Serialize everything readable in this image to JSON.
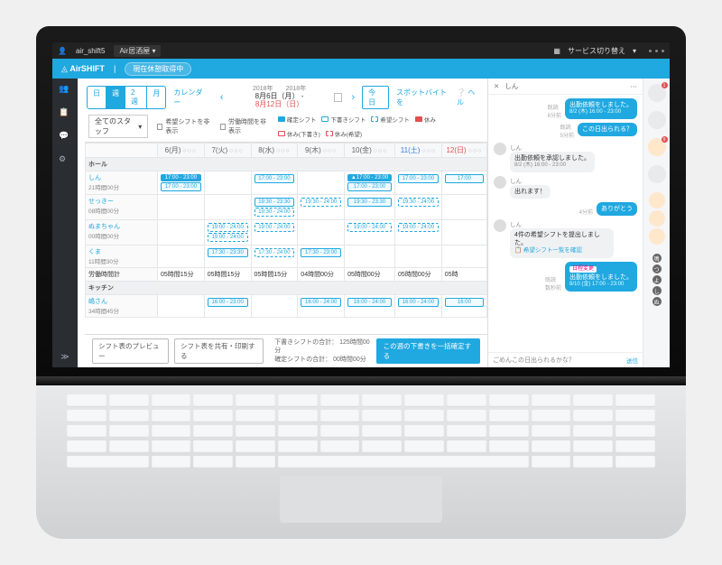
{
  "sysbar": {
    "user": "air_shift5",
    "store": "Air居酒屋",
    "svc": "サービス切り替え"
  },
  "app": {
    "brand": "AirSHIFT",
    "status": "現在休憩取得中"
  },
  "toolbar": {
    "views": [
      "日",
      "週",
      "2週",
      "月"
    ],
    "active": 1,
    "calendar": "カレンダー",
    "year": "2018年",
    "from": "8月6日（月）",
    "to": "8月12日（日）",
    "today": "今日",
    "help": "ヘル",
    "spot": "スポットバイトを"
  },
  "filters": {
    "staff": "全てのスタッフ",
    "cb1": "希望シフトを非表示",
    "cb2": "労働時間を非表示",
    "lg": [
      "確定シフト",
      "下書きシフト",
      "希望シフト",
      "休み",
      "休み(下書き)",
      "休み(希望)"
    ]
  },
  "days": [
    {
      "n": "6",
      "w": "(月)",
      "cls": ""
    },
    {
      "n": "7",
      "w": "(火)",
      "cls": ""
    },
    {
      "n": "8",
      "w": "(水)",
      "cls": ""
    },
    {
      "n": "9",
      "w": "(木)",
      "cls": ""
    },
    {
      "n": "10",
      "w": "(金)",
      "cls": ""
    },
    {
      "n": "11",
      "w": "(土)",
      "cls": "sat"
    },
    {
      "n": "12",
      "w": "(日)",
      "cls": "sun"
    }
  ],
  "sections": {
    "hall": "ホール",
    "sum": "労働時間計",
    "kitchen": "キッチン"
  },
  "staff": [
    {
      "nm": "しん",
      "hrs": "21時間00分",
      "cells": [
        [
          {
            "t": "17:00 - 23:00",
            "s": "c-solid"
          },
          {
            "t": "17:00 - 23:00",
            "s": "c-outline"
          }
        ],
        [],
        [
          {
            "t": "17:00 - 23:00",
            "s": "c-outline"
          }
        ],
        [],
        [
          {
            "t": "▲17:00 - 23:00",
            "s": "c-solid"
          },
          {
            "t": "17:00 - 23:00",
            "s": "c-outline"
          }
        ],
        [
          {
            "t": "17:00 - 23:00",
            "s": "c-outline"
          }
        ],
        [
          {
            "t": "17:00",
            "s": "c-outline"
          }
        ]
      ]
    },
    {
      "nm": "せっきー",
      "hrs": "08時間00分",
      "cells": [
        [],
        [],
        [
          {
            "t": "19:30 - 23:30",
            "s": "c-outline"
          },
          {
            "t": "19:30 - 24:00",
            "s": "c-dash"
          }
        ],
        [
          {
            "t": "19:30 - 24:00",
            "s": "c-dash"
          }
        ],
        [
          {
            "t": "19:30 - 23:30",
            "s": "c-outline"
          }
        ],
        [
          {
            "t": "19:30 - 24:00",
            "s": "c-dash"
          }
        ],
        []
      ]
    },
    {
      "nm": "ぬまちゃん",
      "hrs": "00時間00分",
      "cells": [
        [],
        [
          {
            "t": "19:00 - 24:00",
            "s": "c-dash"
          },
          {
            "t": "19:00 - 24:00",
            "s": "c-dash"
          }
        ],
        [
          {
            "t": "19:00 - 24:00",
            "s": "c-dash"
          }
        ],
        [],
        [
          {
            "t": "19:00 - 24:00",
            "s": "c-dash"
          }
        ],
        [
          {
            "t": "19:00 - 24:00",
            "s": "c-dash"
          }
        ],
        []
      ]
    },
    {
      "nm": "くま",
      "hrs": "11時間30分",
      "cells": [
        [],
        [
          {
            "t": "17:30 - 23:30",
            "s": "c-outline"
          }
        ],
        [
          {
            "t": "17:30 - 24:00",
            "s": "c-dash"
          }
        ],
        [
          {
            "t": "17:30 - 23:00",
            "s": "c-outline"
          }
        ],
        [],
        [],
        []
      ]
    }
  ],
  "sums": [
    "05時間15分",
    "05時間15分",
    "05時間15分",
    "04時間00分",
    "05時間00分",
    "05時間00分",
    "05時"
  ],
  "kitchen": {
    "nm": "嶋さん",
    "hrs": "34時間45分",
    "cells": [
      [],
      [
        {
          "t": "16:00 - 23:00",
          "s": "c-outline"
        }
      ],
      [],
      [
        {
          "t": "16:00 - 24:00",
          "s": "c-outline"
        }
      ],
      [
        {
          "t": "16:00 - 24:00",
          "s": "c-outline"
        }
      ],
      [
        {
          "t": "16:00 - 24:00",
          "s": "c-outline"
        }
      ],
      [
        {
          "t": "16:00",
          "s": "c-outline"
        }
      ]
    ]
  },
  "footer": {
    "preview": "シフト表のプレビュー",
    "share": "シフト表を共有・印刷する",
    "l1": "下書きシフトの合計：",
    "v1": "125時間00分",
    "l2": "確定シフトの合計：",
    "v2": "00時間00分",
    "confirm": "この週の下書きを一括確定する"
  },
  "chat": {
    "title": "しん",
    "msgs": [
      {
        "me": true,
        "t": "出勤依頼をしました。",
        "sub": "8/2 (木) 16:00 - 23:00",
        "read": "既読\n6分前"
      },
      {
        "me": true,
        "t": "この日出られる？",
        "read": "既読\n5分前"
      },
      {
        "me": false,
        "nm": "しん",
        "t": "出勤依頼を承認しました。",
        "sub": "8/2 (木) 16:00 - 23:00"
      },
      {
        "me": false,
        "nm": "しん",
        "t": "出れます！"
      },
      {
        "me": true,
        "t": "ありがとう",
        "read": "4分前"
      },
      {
        "me": false,
        "nm": "しん",
        "t": "4件の希望シフトを提出しました。",
        "link": "希望シフト一覧を確認"
      },
      {
        "me": true,
        "t": "出勤依頼をしました。",
        "sub": "8/10 (金) 17:00 - 23:00",
        "pill": "日程変更",
        "read": "既読\n数秒前"
      }
    ],
    "foot": "ごめんこの日出られるかな？",
    "send": "送信"
  },
  "rnav": {
    "tags": [
      "鳴",
      "つ",
      "よ",
      "し",
      "ぬ"
    ],
    "badge1": "1",
    "badge2": "9"
  }
}
